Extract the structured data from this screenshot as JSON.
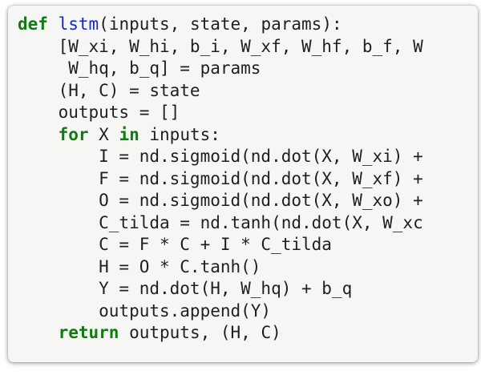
{
  "code": {
    "lines": [
      [
        {
          "t": "def",
          "c": "kw"
        },
        {
          "t": " ",
          "c": "plain"
        },
        {
          "t": "lstm",
          "c": "fn"
        },
        {
          "t": "(inputs, state, params):",
          "c": "plain"
        }
      ],
      [
        {
          "t": "    [W_xi, W_hi, b_i, W_xf, W_hf, b_f, W",
          "c": "plain"
        }
      ],
      [
        {
          "t": "     W_hq, b_q] = params",
          "c": "plain"
        }
      ],
      [
        {
          "t": "    (H, C) = state",
          "c": "plain"
        }
      ],
      [
        {
          "t": "    outputs = []",
          "c": "plain"
        }
      ],
      [
        {
          "t": "    ",
          "c": "plain"
        },
        {
          "t": "for",
          "c": "kw"
        },
        {
          "t": " X ",
          "c": "plain"
        },
        {
          "t": "in",
          "c": "kw"
        },
        {
          "t": " inputs:",
          "c": "plain"
        }
      ],
      [
        {
          "t": "        I = nd.sigmoid(nd.dot(X, W_xi) +",
          "c": "plain"
        }
      ],
      [
        {
          "t": "        F = nd.sigmoid(nd.dot(X, W_xf) +",
          "c": "plain"
        }
      ],
      [
        {
          "t": "        O = nd.sigmoid(nd.dot(X, W_xo) +",
          "c": "plain"
        }
      ],
      [
        {
          "t": "        C_tilda = nd.tanh(nd.dot(X, W_xc",
          "c": "plain"
        }
      ],
      [
        {
          "t": "        C = F * C + I * C_tilda",
          "c": "plain"
        }
      ],
      [
        {
          "t": "        H = O * C.tanh()",
          "c": "plain"
        }
      ],
      [
        {
          "t": "        Y = nd.dot(H, W_hq) + b_q",
          "c": "plain"
        }
      ],
      [
        {
          "t": "        outputs.append(Y)",
          "c": "plain"
        }
      ],
      [
        {
          "t": "    ",
          "c": "plain"
        },
        {
          "t": "return",
          "c": "kw"
        },
        {
          "t": " outputs, (H, C)",
          "c": "plain"
        }
      ]
    ]
  },
  "colors": {
    "keyword": "#117a11",
    "function_name": "#1a24c8",
    "text": "#1f1f1f",
    "background": "#f6f6f4"
  }
}
